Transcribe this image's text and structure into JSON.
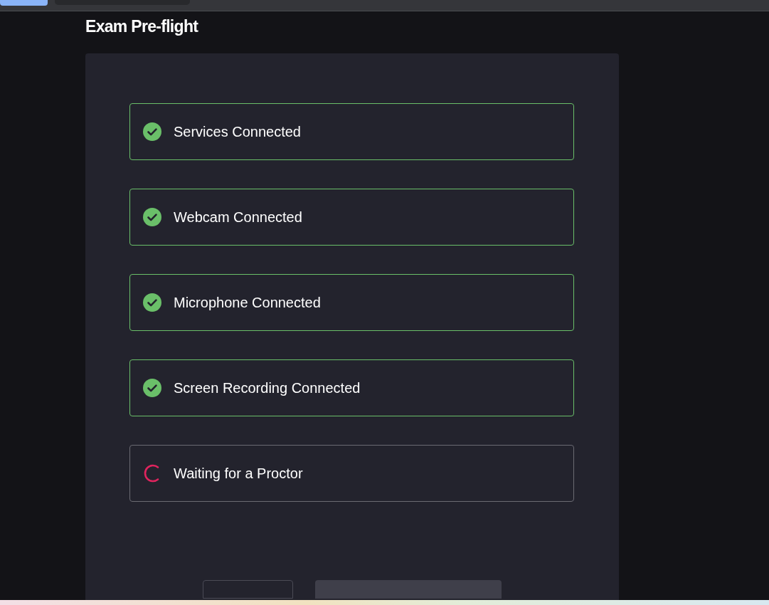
{
  "title": "Exam Pre-flight",
  "checks": [
    {
      "label": "Services Connected",
      "kind": "done"
    },
    {
      "label": "Webcam Connected",
      "kind": "done"
    },
    {
      "label": "Microphone Connected",
      "kind": "done"
    },
    {
      "label": "Screen Recording Connected",
      "kind": "done"
    },
    {
      "label": "Waiting for a Proctor",
      "kind": "pending"
    }
  ],
  "buttons": [
    {
      "kind": "outlined",
      "disabled": false
    },
    {
      "kind": "filled",
      "disabled": true
    }
  ]
}
